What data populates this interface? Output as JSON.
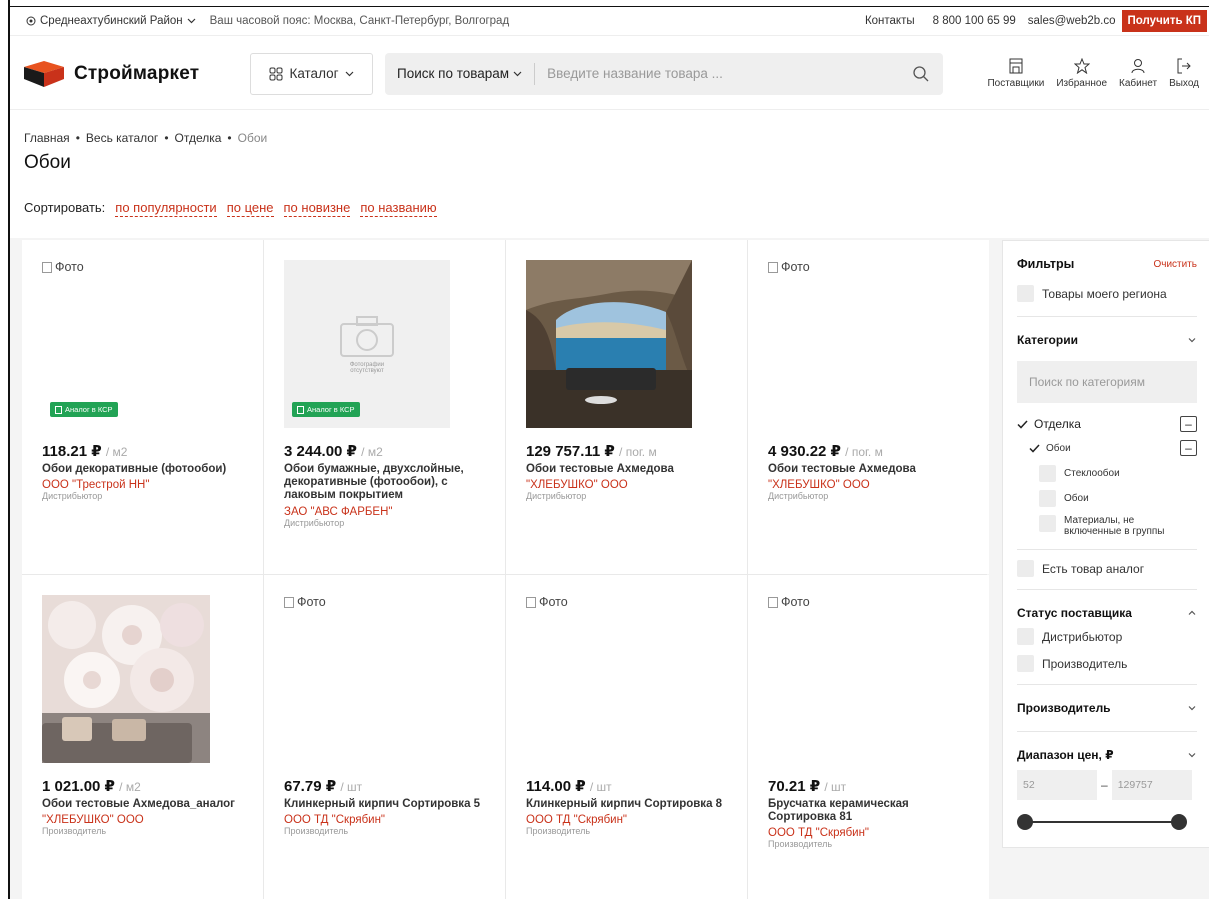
{
  "topbar": {
    "region": "Среднеахтубинский Район",
    "timezone": "Ваш часовой пояс: Москва, Санкт-Петербург, Волгоград",
    "contacts": "Контакты",
    "phone": "8 800 100 65 99",
    "email": "sales@web2b.co",
    "cta": "Получить КП"
  },
  "header": {
    "logo": "Строймаркет",
    "catalog": "Каталог",
    "search_scope": "Поиск по товарам",
    "search_placeholder": "Введите название товара ...",
    "icons": [
      {
        "label": "Поставщики",
        "icon": "store-icon"
      },
      {
        "label": "Избранное",
        "icon": "star-icon"
      },
      {
        "label": "Кабинет",
        "icon": "user-icon"
      },
      {
        "label": "Выход",
        "icon": "logout-icon"
      }
    ]
  },
  "breadcrumbs": [
    "Главная",
    "Весь каталог",
    "Отделка",
    "Обои"
  ],
  "page_title": "Обои",
  "sort": {
    "label": "Сортировать:",
    "options": [
      "по популярности",
      "по цене",
      "по новизне",
      "по названию"
    ]
  },
  "products": [
    {
      "image": "broken",
      "alt": "Фото",
      "badge": "Аналог в КСР",
      "price": "118.21 ₽",
      "unit": "/ м2",
      "name": "Обои декоративные (фотообои)",
      "vendor": "ООО \"Трестрой НН\"",
      "vendor_type": "Дистрибьютор"
    },
    {
      "image": "none",
      "no_photo_text": "Фотографии отсутствуют",
      "badge": "Аналог в КСР",
      "price": "3 244.00 ₽",
      "unit": "/ м2",
      "name": "Обои бумажные, двухслойные, декоративные (фотообои), с лаковым покрытием",
      "vendor": "ЗАО \"АВС ФАРБЕН\"",
      "vendor_type": "Дистрибьютор"
    },
    {
      "image": "photo-cave",
      "price": "129 757.11 ₽",
      "unit": "/ пог. м",
      "name": "Обои тестовые Ахмедова",
      "vendor": "\"ХЛЕБУШКО\" ООО",
      "vendor_type": "Дистрибьютор"
    },
    {
      "image": "broken",
      "alt": "Фото",
      "price": "4 930.22 ₽",
      "unit": "/ пог. м",
      "name": "Обои тестовые Ахмедова",
      "vendor": "\"ХЛЕБУШКО\" ООО",
      "vendor_type": "Дистрибьютор"
    },
    {
      "image": "photo-flowers",
      "price": "1 021.00 ₽",
      "unit": "/ м2",
      "name": "Обои тестовые Ахмедова_аналог",
      "vendor": "\"ХЛЕБУШКО\" ООО",
      "vendor_type": "Производитель"
    },
    {
      "image": "broken",
      "alt": "Фото",
      "price": "67.79 ₽",
      "unit": "/ шт",
      "name": "Клинкерный кирпич Сортировка 5",
      "vendor": "ООО ТД \"Скрябин\"",
      "vendor_type": "Производитель"
    },
    {
      "image": "broken",
      "alt": "Фото",
      "price": "114.00 ₽",
      "unit": "/ шт",
      "name": "Клинкерный кирпич Сортировка 8",
      "vendor": "ООО ТД \"Скрябин\"",
      "vendor_type": "Производитель"
    },
    {
      "image": "broken",
      "alt": "Фото",
      "price": "70.21 ₽",
      "unit": "/ шт",
      "name": "Брусчатка керамическая Сортировка 81",
      "vendor": "ООО ТД \"Скрябин\"",
      "vendor_type": "Производитель"
    }
  ],
  "filters": {
    "title": "Фильтры",
    "clear": "Очистить",
    "my_region": "Товары моего региона",
    "categories_title": "Категории",
    "categories_search_placeholder": "Поиск по категориям",
    "tree": {
      "level1": "Отделка",
      "level2": "Обои",
      "children": [
        "Стеклообои",
        "Обои",
        "Материалы, не включенные в группы"
      ]
    },
    "has_analog": "Есть товар аналог",
    "supplier_status_title": "Статус поставщика",
    "supplier_status_options": [
      "Дистрибьютор",
      "Производитель"
    ],
    "manufacturer_title": "Производитель",
    "price_range_title": "Диапазон цен, ₽",
    "price_min": "52",
    "price_max": "129757",
    "price_range_fill": 1.0
  },
  "colors": {
    "accent": "#c9321a",
    "badge_green": "#22a355",
    "slider": "#333333"
  }
}
